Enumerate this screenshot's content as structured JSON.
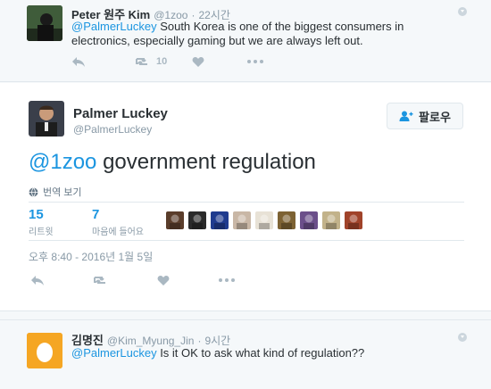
{
  "top_reply": {
    "name": "Peter 원주 Kim",
    "handle": "@1zoo",
    "time": "22시간",
    "mention": "@PalmerLuckey",
    "text": " South Korea is one of the biggest consumers in electronics, especially gaming but we are always left out.",
    "retweet_count": "10"
  },
  "main_tweet": {
    "name": "Palmer Luckey",
    "handle": "@PalmerLuckey",
    "follow_label": "팔로우",
    "mention": "@1zoo",
    "text": " government regulation",
    "translate_label": "번역 보기",
    "retweets_count": "15",
    "retweets_label": "리트윗",
    "likes_count": "7",
    "likes_label": "마음에 들어요",
    "timestamp": "오후 8:40 - 2016년 1월 5일",
    "liker_avatar_colors": [
      "#5a3d2b",
      "#2b2b2b",
      "#1f3b8f",
      "#c9b7a6",
      "#e8e2d6",
      "#7d6233",
      "#6b4f8a",
      "#c2b28a",
      "#a0432a"
    ]
  },
  "bottom_reply": {
    "name": "김명진",
    "handle": "@Kim_Myung_Jin",
    "time": "9시간",
    "mention": "@PalmerLuckey",
    "text": " Is it OK to ask what kind of regulation??"
  },
  "colors": {
    "link": "#1b95e0",
    "egg_avatar": "#f5a623"
  }
}
